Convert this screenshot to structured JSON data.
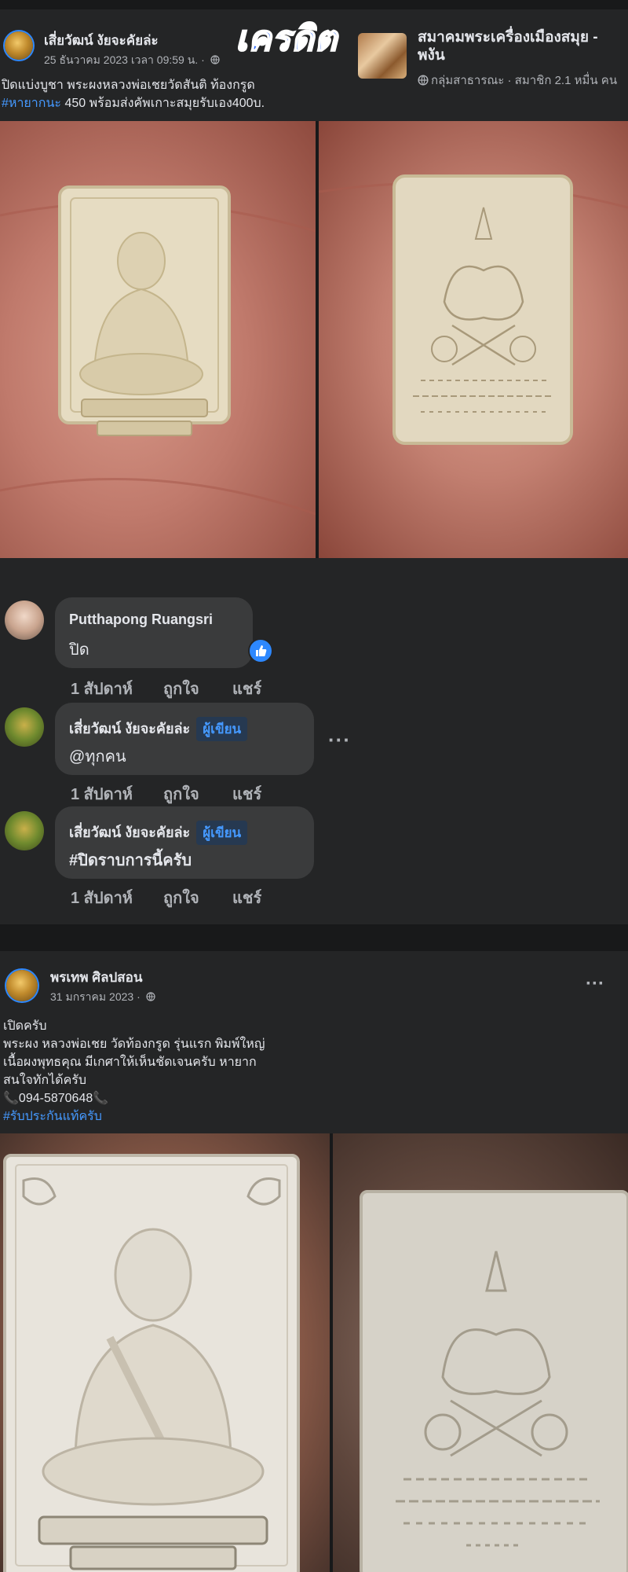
{
  "post1": {
    "author": "เสี่ยวัฒน์ งัยจะคัยล่ะ",
    "timestamp": "25 ธันวาคม 2023 เวลา 09:59 น. ·",
    "stamp": "เครดิต",
    "group": {
      "name_line1": "สมาคมพระเครื่องเมืองสมุย -",
      "name_line2": "พงัน",
      "meta": "กลุ่มสาธารณะ · สมาชิก 2.1 หมื่น คน"
    },
    "text_line1": "ปิดแบ่งบูชา พระผงหลวงพ่อเชยวัดสันติ ท้องกรูด",
    "hashtag": "#หายากนะ",
    "text_line2_rest": " 450 พร้อมส่งคัพเกาะสมุยรับเอง400บ.",
    "photos": [
      "amulet-front-photo",
      "amulet-back-photo"
    ]
  },
  "comments": [
    {
      "name": "Putthapong Ruangsri",
      "text": "ปิด",
      "badge": "",
      "time": "1 สัปดาห์",
      "like": "ถูกใจ",
      "reply": "แชร์"
    },
    {
      "name": "เสี่ยวัฒน์ งัยจะคัยล่ะ",
      "text": "@ทุกคน",
      "badge": "ผู้เขียน",
      "time": "1 สัปดาห์",
      "like": "ถูกใจ",
      "reply": "แชร์"
    },
    {
      "name": "เสี่ยวัฒน์ งัยจะคัยล่ะ",
      "text": "#ปิดราบการนี้ครับ",
      "badge": "ผู้เขียน",
      "time": "1 สัปดาห์",
      "like": "ถูกใจ",
      "reply": "แชร์"
    }
  ],
  "post2": {
    "author": "พรเทพ ศิลปสอน",
    "timestamp": "31 มกราคม 2023 ·",
    "more": "···",
    "lines": [
      "เปิดครับ",
      "พระผง หลวงพ่อเชย วัดท้องกรูด รุ่นแรก พิมพ์ใหญ่",
      "เนื้อผงพุทธคุณ มีเกศาให้เห็นชัดเจนครับ หายาก",
      "สนใจทักได้ครับ",
      "📞094-5870648📞"
    ],
    "hashtag": "#รับประกันแท้ครับ"
  },
  "colors": {
    "background": "#18191a",
    "card": "#242526",
    "bubble": "#3a3b3c",
    "link": "#4599ff",
    "stamp": "#2f6bff"
  },
  "icons": [
    "globe-icon",
    "like-reaction-icon",
    "more-options-icon"
  ]
}
